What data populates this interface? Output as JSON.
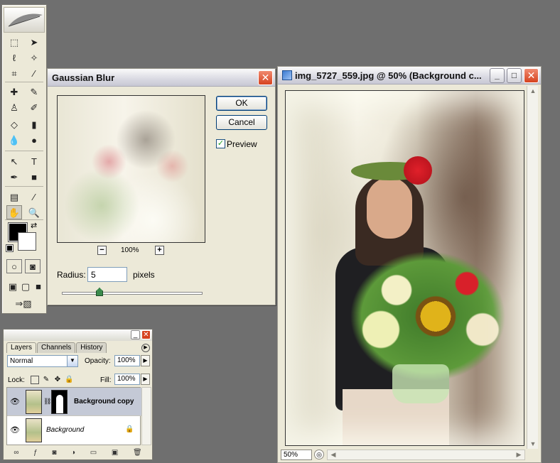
{
  "colors": {
    "desktop": "#6f6f6f",
    "chrome": "#ece9d8",
    "close_red": "#d6421f",
    "foreground": "#000000",
    "background": "#ffffff"
  },
  "toolbox": {
    "tools": [
      {
        "name": "marquee-tool-icon",
        "glyph": "⬚"
      },
      {
        "name": "move-tool-icon",
        "glyph": "➤"
      },
      {
        "name": "lasso-tool-icon",
        "glyph": "ℓ"
      },
      {
        "name": "magic-wand-tool-icon",
        "glyph": "✧"
      },
      {
        "name": "crop-tool-icon",
        "glyph": "⌗"
      },
      {
        "name": "slice-tool-icon",
        "glyph": "⁄"
      },
      {
        "name": "healing-brush-tool-icon",
        "glyph": "✚"
      },
      {
        "name": "brush-tool-icon",
        "glyph": "✎"
      },
      {
        "name": "clone-stamp-tool-icon",
        "glyph": "♙"
      },
      {
        "name": "history-brush-tool-icon",
        "glyph": "✐"
      },
      {
        "name": "eraser-tool-icon",
        "glyph": "◇"
      },
      {
        "name": "gradient-tool-icon",
        "glyph": "▮"
      },
      {
        "name": "blur-tool-icon",
        "glyph": "💧"
      },
      {
        "name": "dodge-tool-icon",
        "glyph": "●"
      },
      {
        "name": "path-selection-tool-icon",
        "glyph": "↖"
      },
      {
        "name": "type-tool-icon",
        "glyph": "T"
      },
      {
        "name": "pen-tool-icon",
        "glyph": "✒"
      },
      {
        "name": "shape-tool-icon",
        "glyph": "■"
      },
      {
        "name": "notes-tool-icon",
        "glyph": "▤"
      },
      {
        "name": "eyedropper-tool-icon",
        "glyph": "⁄"
      },
      {
        "name": "hand-tool-icon",
        "glyph": "✋"
      },
      {
        "name": "zoom-tool-icon",
        "glyph": "🔍"
      }
    ]
  },
  "dialog": {
    "title": "Gaussian Blur",
    "ok": "OK",
    "cancel": "Cancel",
    "preview_label": "Preview",
    "preview_checked": "✓",
    "zoom_minus": "−",
    "zoom_plus": "+",
    "zoom_level": "100%",
    "radius_label": "Radius:",
    "radius_value": "5",
    "radius_unit": "pixels",
    "close": "✕"
  },
  "image_window": {
    "title": "img_5727_559.jpg @ 50% (Background c...",
    "zoom": "50%",
    "minimize": "_",
    "maximize": "□",
    "close": "✕"
  },
  "layers_palette": {
    "tabs": [
      "Layers",
      "Channels",
      "History"
    ],
    "blend_mode": "Normal",
    "opacity_label": "Opacity:",
    "opacity_value": "100%",
    "lock_label": "Lock:",
    "fill_label": "Fill:",
    "fill_value": "100%",
    "layers": [
      {
        "name": "Background copy",
        "selected": true
      },
      {
        "name": "Background",
        "selected": false
      }
    ],
    "minimize": "_",
    "close": "✕"
  }
}
